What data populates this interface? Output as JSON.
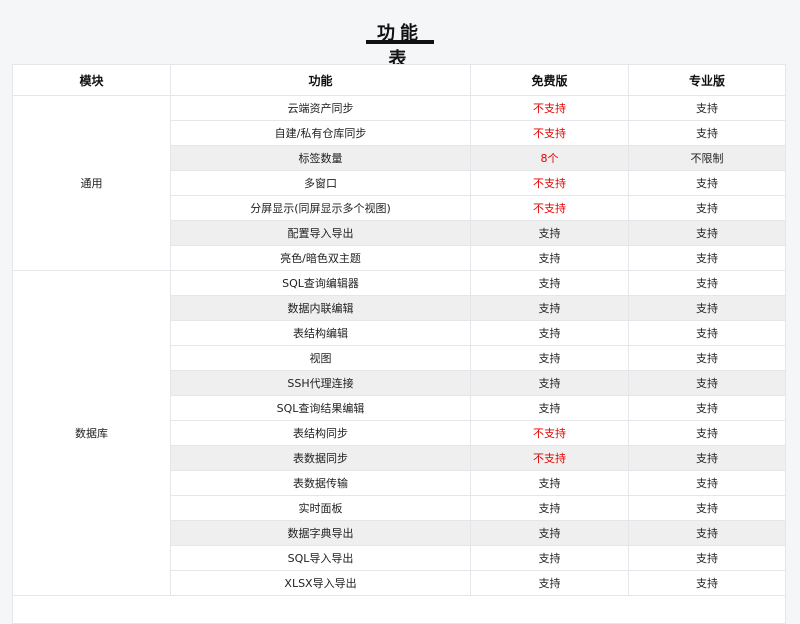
{
  "title": "功能表",
  "headers": [
    "模块",
    "功能",
    "免费版",
    "专业版"
  ],
  "modules": [
    {
      "name": "通用",
      "rows": [
        {
          "feature": "云端资产同步",
          "free": "不支持",
          "pro": "支持",
          "free_red": true
        },
        {
          "feature": "自建/私有仓库同步",
          "free": "不支持",
          "pro": "支持",
          "free_red": true
        },
        {
          "feature": "标签数量",
          "free": "8个",
          "pro": "不限制",
          "free_red": true,
          "shade": true
        },
        {
          "feature": "多窗口",
          "free": "不支持",
          "pro": "支持",
          "free_red": true
        },
        {
          "feature": "分屏显示(同屏显示多个视图)",
          "free": "不支持",
          "pro": "支持",
          "free_red": true
        },
        {
          "feature": "配置导入导出",
          "free": "支持",
          "pro": "支持",
          "shade": true
        },
        {
          "feature": "亮色/暗色双主题",
          "free": "支持",
          "pro": "支持"
        }
      ]
    },
    {
      "name": "数据库",
      "rows": [
        {
          "feature": "SQL查询编辑器",
          "free": "支持",
          "pro": "支持"
        },
        {
          "feature": "数据内联编辑",
          "free": "支持",
          "pro": "支持",
          "shade": true
        },
        {
          "feature": "表结构编辑",
          "free": "支持",
          "pro": "支持"
        },
        {
          "feature": "视图",
          "free": "支持",
          "pro": "支持"
        },
        {
          "feature": "SSH代理连接",
          "free": "支持",
          "pro": "支持",
          "shade": true
        },
        {
          "feature": "SQL查询结果编辑",
          "free": "支持",
          "pro": "支持"
        },
        {
          "feature": "表结构同步",
          "free": "不支持",
          "pro": "支持",
          "free_red": true
        },
        {
          "feature": "表数据同步",
          "free": "不支持",
          "pro": "支持",
          "free_red": true,
          "shade": true
        },
        {
          "feature": "表数据传输",
          "free": "支持",
          "pro": "支持"
        },
        {
          "feature": "实时面板",
          "free": "支持",
          "pro": "支持"
        },
        {
          "feature": "数据字典导出",
          "free": "支持",
          "pro": "支持",
          "shade": true
        },
        {
          "feature": "SQL导入导出",
          "free": "支持",
          "pro": "支持"
        },
        {
          "feature": "XLSX导入导出",
          "free": "支持",
          "pro": "支持"
        }
      ]
    }
  ],
  "colors": {
    "unsupported": "#e60000",
    "shade": "#efefef"
  }
}
